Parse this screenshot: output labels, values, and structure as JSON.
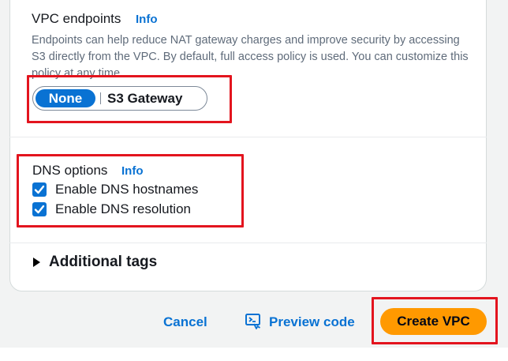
{
  "vpc_endpoints": {
    "label": "VPC endpoints",
    "info": "Info",
    "description": "Endpoints can help reduce NAT gateway charges and improve security by accessing S3 directly from the VPC. By default, full access policy is used. You can customize this policy at any time.",
    "options": [
      "None",
      "S3 Gateway"
    ],
    "selected": "None"
  },
  "dns_options": {
    "label": "DNS options",
    "info": "Info",
    "checkboxes": [
      {
        "label": "Enable DNS hostnames",
        "checked": true
      },
      {
        "label": "Enable DNS resolution",
        "checked": true
      }
    ]
  },
  "additional_tags": {
    "label": "Additional tags",
    "expanded": false
  },
  "footer": {
    "cancel": "Cancel",
    "preview_code": "Preview code",
    "create": "Create VPC"
  },
  "colors": {
    "primary": "#ff9900",
    "link": "#0972d3",
    "highlight": "#e3141e"
  }
}
